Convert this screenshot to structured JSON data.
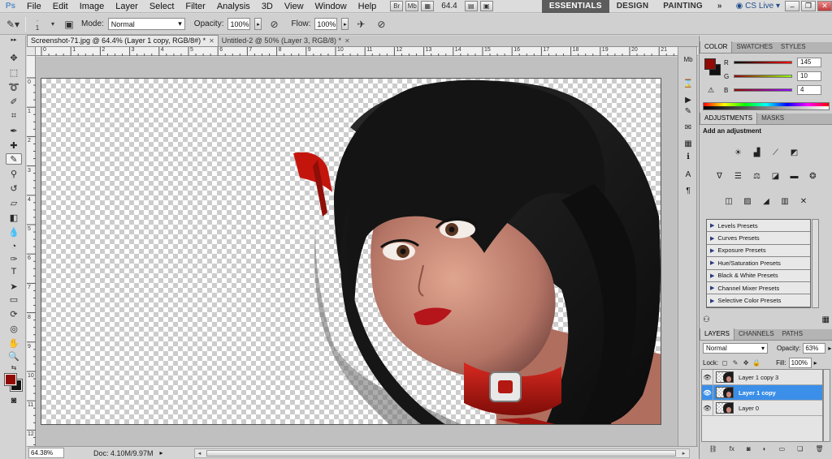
{
  "app": {
    "logo": "Ps"
  },
  "menu": {
    "items": [
      "File",
      "Edit",
      "Image",
      "Layer",
      "Select",
      "Filter",
      "Analysis",
      "3D",
      "View",
      "Window",
      "Help"
    ],
    "zoom": "64.4",
    "workspaces": [
      "ESSENTIALS",
      "DESIGN",
      "PAINTING"
    ],
    "more": "»",
    "cs_live": "CS Live"
  },
  "options": {
    "brush_size": "1",
    "mode_label": "Mode:",
    "mode_value": "Normal",
    "opacity_label": "Opacity:",
    "opacity_value": "100%",
    "flow_label": "Flow:",
    "flow_value": "100%"
  },
  "doc_tabs": [
    {
      "label": "Screenshot-71.jpg @ 64.4% (Layer 1 copy, RGB/8#) *",
      "active": true
    },
    {
      "label": "Untitled-2 @ 50% (Layer 3, RGB/8) *",
      "active": false
    }
  ],
  "ruler": {
    "h_labels": [
      "0",
      "1",
      "2",
      "3",
      "4",
      "5",
      "6",
      "7",
      "8",
      "9",
      "10",
      "11",
      "12",
      "13",
      "14",
      "15",
      "16",
      "17",
      "18",
      "19",
      "20",
      "21",
      "22"
    ],
    "v_labels": [
      "0",
      "1",
      "2",
      "3",
      "4",
      "5",
      "6",
      "7",
      "8",
      "9",
      "10",
      "11",
      "12"
    ]
  },
  "status": {
    "zoom": "64.38%",
    "doc": "Doc: 4.10M/9.97M"
  },
  "color_panel": {
    "tabs": [
      "COLOR",
      "SWATCHES",
      "STYLES"
    ],
    "foreground": "#910a04",
    "background": "#111111",
    "channels": [
      {
        "label": "R",
        "value": "145"
      },
      {
        "label": "G",
        "value": "10"
      },
      {
        "label": "B",
        "value": "4"
      }
    ]
  },
  "adjustments_panel": {
    "tabs": [
      "ADJUSTMENTS",
      "MASKS"
    ],
    "title": "Add an adjustment",
    "presets": [
      "Levels Presets",
      "Curves Presets",
      "Exposure Presets",
      "Hue/Saturation Presets",
      "Black & White Presets",
      "Channel Mixer Presets",
      "Selective Color Presets"
    ]
  },
  "layers_panel": {
    "tabs": [
      "LAYERS",
      "CHANNELS",
      "PATHS"
    ],
    "blend_mode": "Normal",
    "opacity_label": "Opacity:",
    "opacity_value": "63%",
    "lock_label": "Lock:",
    "fill_label": "Fill:",
    "fill_value": "100%",
    "layers": [
      {
        "name": "Layer 1 copy 3",
        "selected": false
      },
      {
        "name": "Layer 1 copy",
        "selected": true
      },
      {
        "name": "Layer 0",
        "selected": false
      }
    ],
    "footer_icons": [
      "link-icon",
      "fx-icon",
      "mask-icon",
      "adjustment-layer-icon",
      "group-icon",
      "new-layer-icon",
      "trash-icon"
    ]
  }
}
